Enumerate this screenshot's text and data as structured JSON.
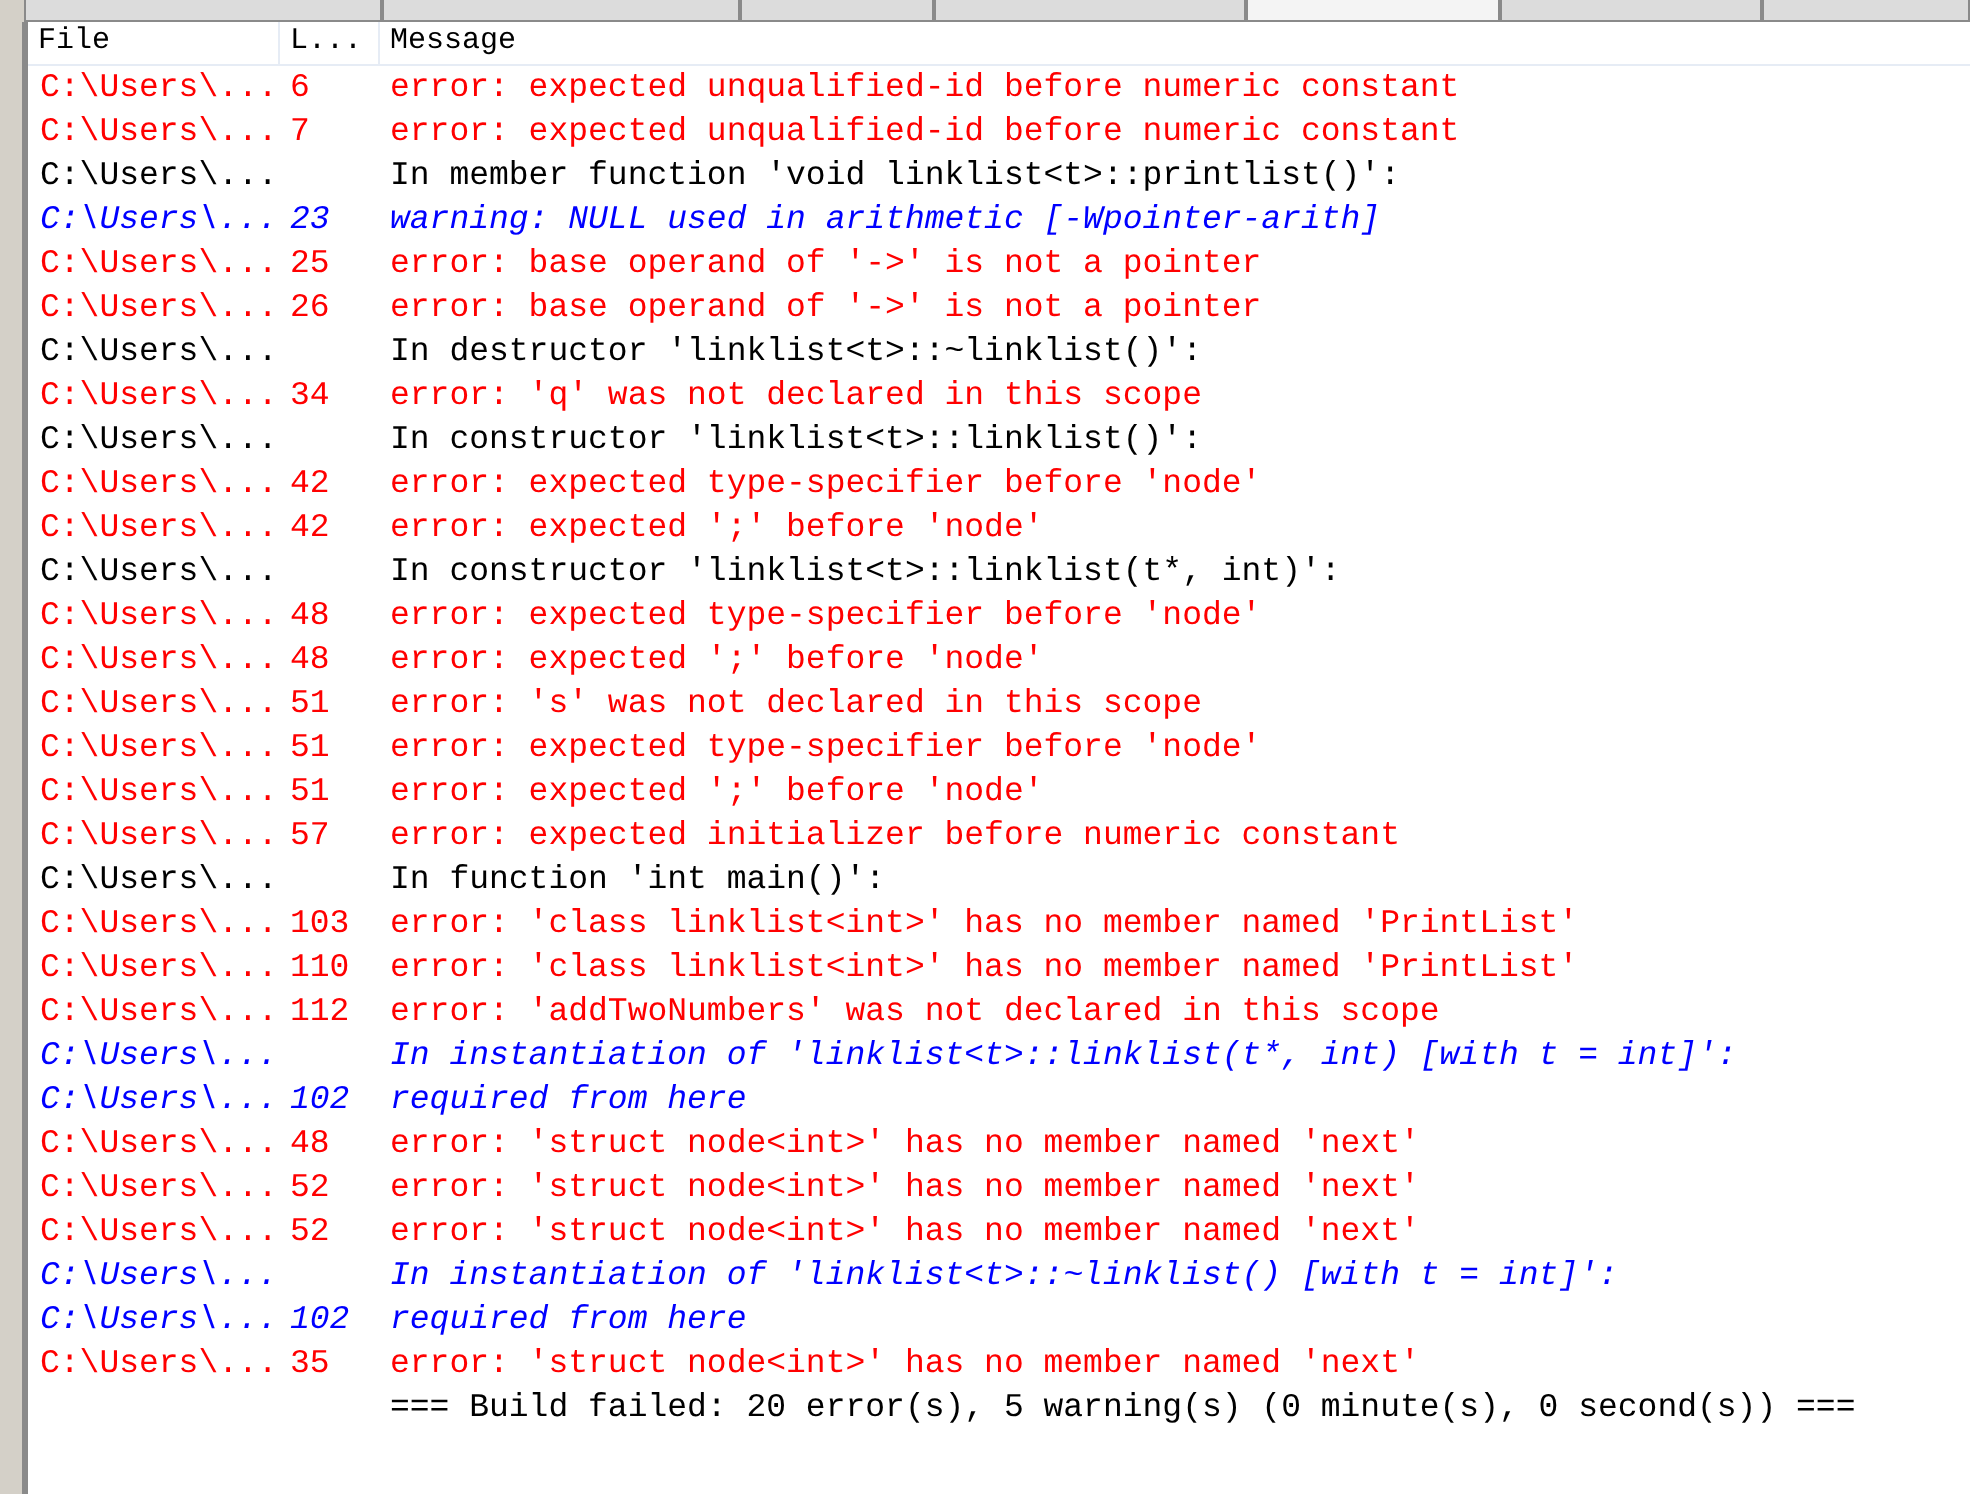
{
  "tabs": [
    {
      "selected": false
    },
    {
      "selected": false
    },
    {
      "selected": false
    },
    {
      "selected": false
    },
    {
      "selected": true
    },
    {
      "selected": false
    },
    {
      "selected": false
    }
  ],
  "columns": [
    "File",
    "L...",
    "Message"
  ],
  "rows": [
    {
      "kind": "error",
      "file": "C:\\Users\\...",
      "line": "6",
      "message": "error: expected unqualified-id before numeric constant"
    },
    {
      "kind": "error",
      "file": "C:\\Users\\...",
      "line": "7",
      "message": "error: expected unqualified-id before numeric constant"
    },
    {
      "kind": "info",
      "file": "C:\\Users\\...",
      "message": "In member function 'void linklist<t>::printlist()':"
    },
    {
      "kind": "warning",
      "file": "C:\\Users\\...",
      "line": "23",
      "message": "warning: NULL used in arithmetic [-Wpointer-arith]"
    },
    {
      "kind": "error",
      "file": "C:\\Users\\...",
      "line": "25",
      "message": "error: base operand of '->' is not a pointer"
    },
    {
      "kind": "error",
      "file": "C:\\Users\\...",
      "line": "26",
      "message": "error: base operand of '->' is not a pointer"
    },
    {
      "kind": "info",
      "file": "C:\\Users\\...",
      "message": "In destructor 'linklist<t>::~linklist()':"
    },
    {
      "kind": "error",
      "file": "C:\\Users\\...",
      "line": "34",
      "message": "error: 'q' was not declared in this scope"
    },
    {
      "kind": "info",
      "file": "C:\\Users\\...",
      "message": "In constructor 'linklist<t>::linklist()':"
    },
    {
      "kind": "error",
      "file": "C:\\Users\\...",
      "line": "42",
      "message": "error: expected type-specifier before 'node'"
    },
    {
      "kind": "error",
      "file": "C:\\Users\\...",
      "line": "42",
      "message": "error: expected ';' before 'node'"
    },
    {
      "kind": "info",
      "file": "C:\\Users\\...",
      "message": "In constructor 'linklist<t>::linklist(t*, int)':"
    },
    {
      "kind": "error",
      "file": "C:\\Users\\...",
      "line": "48",
      "message": "error: expected type-specifier before 'node'"
    },
    {
      "kind": "error",
      "file": "C:\\Users\\...",
      "line": "48",
      "message": "error: expected ';' before 'node'"
    },
    {
      "kind": "error",
      "file": "C:\\Users\\...",
      "line": "51",
      "message": "error: 's' was not declared in this scope"
    },
    {
      "kind": "error",
      "file": "C:\\Users\\...",
      "line": "51",
      "message": "error: expected type-specifier before 'node'"
    },
    {
      "kind": "error",
      "file": "C:\\Users\\...",
      "line": "51",
      "message": "error: expected ';' before 'node'"
    },
    {
      "kind": "error",
      "file": "C:\\Users\\...",
      "line": "57",
      "message": "error: expected initializer before numeric constant"
    },
    {
      "kind": "info",
      "file": "C:\\Users\\...",
      "message": "In function 'int main()':"
    },
    {
      "kind": "error",
      "file": "C:\\Users\\...",
      "line": "103",
      "message": "error: 'class linklist<int>' has no member named 'PrintList'"
    },
    {
      "kind": "error",
      "file": "C:\\Users\\...",
      "line": "110",
      "message": "error: 'class linklist<int>' has no member named 'PrintList'"
    },
    {
      "kind": "error",
      "file": "C:\\Users\\...",
      "line": "112",
      "message": "error: 'addTwoNumbers' was not declared in this scope"
    },
    {
      "kind": "warning",
      "file": "C:\\Users\\...",
      "message": "In instantiation of 'linklist<t>::linklist(t*, int) [with t = int]':"
    },
    {
      "kind": "warning",
      "file": "C:\\Users\\...",
      "line": "102",
      "message": "required from here"
    },
    {
      "kind": "error",
      "file": "C:\\Users\\...",
      "line": "48",
      "message": "error: 'struct node<int>' has no member named 'next'"
    },
    {
      "kind": "error",
      "file": "C:\\Users\\...",
      "line": "52",
      "message": "error: 'struct node<int>' has no member named 'next'"
    },
    {
      "kind": "error",
      "file": "C:\\Users\\...",
      "line": "52",
      "message": "error: 'struct node<int>' has no member named 'next'"
    },
    {
      "kind": "warning",
      "file": "C:\\Users\\...",
      "message": "In instantiation of 'linklist<t>::~linklist() [with t = int]':"
    },
    {
      "kind": "warning",
      "file": "C:\\Users\\...",
      "line": "102",
      "message": "required from here"
    },
    {
      "kind": "error",
      "file": "C:\\Users\\...",
      "line": "35",
      "message": "error: 'struct node<int>' has no member named 'next'"
    },
    {
      "kind": "info",
      "message": "=== Build failed: 20 error(s), 5 warning(s) (0 minute(s), 0 second(s)) ==="
    }
  ]
}
